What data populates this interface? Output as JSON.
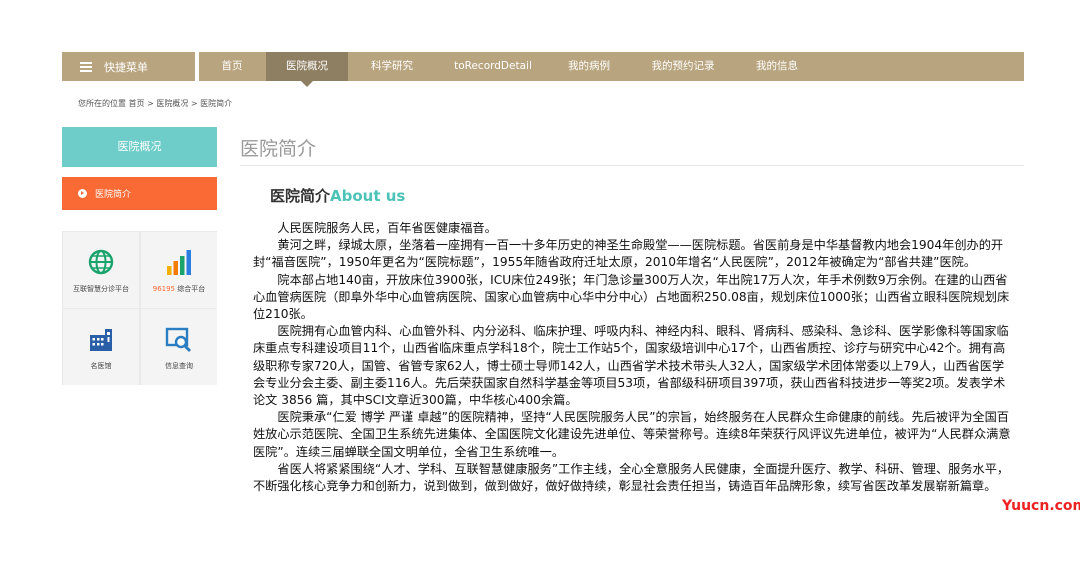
{
  "nav": {
    "menu_label": "快捷菜单",
    "items": [
      {
        "label": "首页"
      },
      {
        "label": "医院概况"
      },
      {
        "label": "科学研究"
      },
      {
        "label": "toRecordDetail"
      },
      {
        "label": "我的病例"
      },
      {
        "label": "我的预约记录"
      },
      {
        "label": "我的信息"
      }
    ],
    "active_index": 1,
    "bar_color": "#b8a57f",
    "active_color": "#8f7f62"
  },
  "breadcrumb": "您所在的位置  首页 > 医院概况 > 医院简介",
  "sidebar": {
    "header": "医院概况",
    "items": [
      {
        "label": "医院简介"
      }
    ],
    "tiles": [
      {
        "label": "互联智慧分诊平台",
        "icon": "globe-icon"
      },
      {
        "label_number": "96195",
        "label": "综合平台",
        "icon": "bar-chart-icon"
      },
      {
        "label": "名医馆",
        "icon": "building-icon"
      },
      {
        "label": "信息查询",
        "icon": "search-monitor-icon"
      }
    ],
    "header_color": "#6ecdc8",
    "active_color": "#fa6a35"
  },
  "content": {
    "page_title": "医院简介",
    "section_title_cn": "医院简介",
    "section_title_en": "About us",
    "paragraphs": [
      "人民医院服务人民，百年省医健康福音。",
      "黄河之畔，绿城太原，坐落着一座拥有一百一十多年历史的神圣生命殿堂——医院标题。省医前身是中华基督教内地会1904年创办的开封“福音医院”，1950年更名为“医院标题”，1955年随省政府迁址太原，2010年增名“人民医院”，2012年被确定为“部省共建”医院。",
      "院本部占地140亩，开放床位3900张，ICU床位249张；年门急诊量300万人次，年出院17万人次，年手术例数9万余例。在建的山西省心血管病医院（即阜外华中心血管病医院、国家心血管病中心华中分中心）占地面积250.08亩，规划床位1000张；山西省立眼科医院规划床位210张。",
      "医院拥有心血管内科、心血管外科、内分泌科、临床护理、呼吸内科、神经内科、眼科、肾病科、感染科、急诊科、医学影像科等国家临床重点专科建设项目11个，山西省临床重点学科18个，院士工作站5个，国家级培训中心17个，山西省质控、诊疗与研究中心42个。拥有高级职称专家720人，国管、省管专家62人，博士硕士导师142人，山西省学术技术带头人32人，国家级学术团体常委以上79人，山西省医学会专业分会主委、副主委116人。先后荣获国家自然科学基金等项目53项，省部级科研项目397项，获山西省科技进步一等奖2项。发表学术论文 3856 篇，其中SCI文章近300篇，中华核心400余篇。",
      "医院秉承“仁爱 博学 严谨 卓越”的医院精神，坚持“人民医院服务人民”的宗旨，始终服务在人民群众生命健康的前线。先后被评为全国百姓放心示范医院、全国卫生系统先进集体、全国医院文化建设先进单位、等荣誉称号。连续8年荣获行风评议先进单位，被评为“人民群众满意医院”。连续三届蝉联全国文明单位，全省卫生系统唯一。",
      "省医人将紧紧围绕“人才、学科、互联智慧健康服务”工作主线，全心全意服务人民健康，全面提升医疗、教学、科研、管理、服务水平，不断强化核心竞争力和创新力，说到做到，做到做好，做好做持续，彰显社会责任担当，铸造百年品牌形象，续写省医改革发展崭新篇章。"
    ]
  },
  "watermark": "Yuucn.com",
  "colors": {
    "accent_teal": "#4cc3b6",
    "orange": "#fa6a35"
  }
}
